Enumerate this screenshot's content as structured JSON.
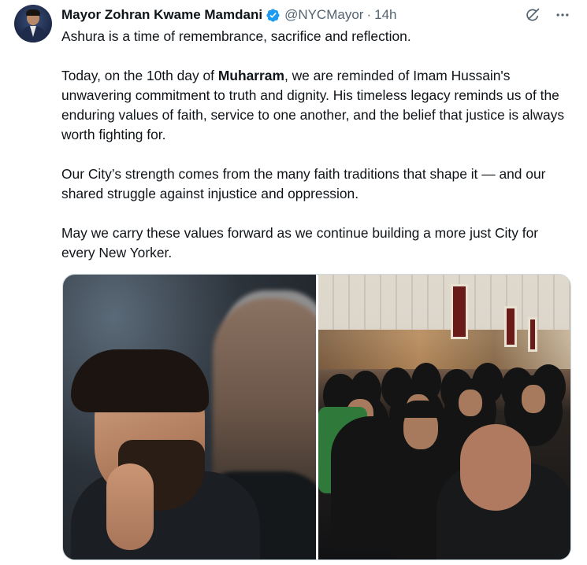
{
  "tweet": {
    "author_name": "Mayor Zohran Kwame Mamdani",
    "handle": "@NYCMayor",
    "separator": "·",
    "time": "14h",
    "paragraphs": {
      "p1": "Ashura is a time of remembrance, sacrifice and reflection.",
      "p2_before": "Today, on the 10th day of ",
      "p2_bold": "Muharram",
      "p2_after": ", we are reminded of Imam Hussain's unwavering commitment to truth and dignity. His timeless legacy reminds us of the enduring values of faith, service to one another, and the belief that justice is always worth fighting for.",
      "p3": "Our City’s strength comes from the many faith traditions that shape it — and our shared struggle against injustice and oppression.",
      "p4": "May we carry these values forward as we continue building a more just City for every New Yorker."
    }
  },
  "icons": {
    "verified": "verified-badge-icon",
    "grok": "grok-icon",
    "more": "more-icon"
  },
  "colors": {
    "verified_blue": "#1d9bf0",
    "secondary_text": "#536471",
    "primary_text": "#0f1419"
  }
}
